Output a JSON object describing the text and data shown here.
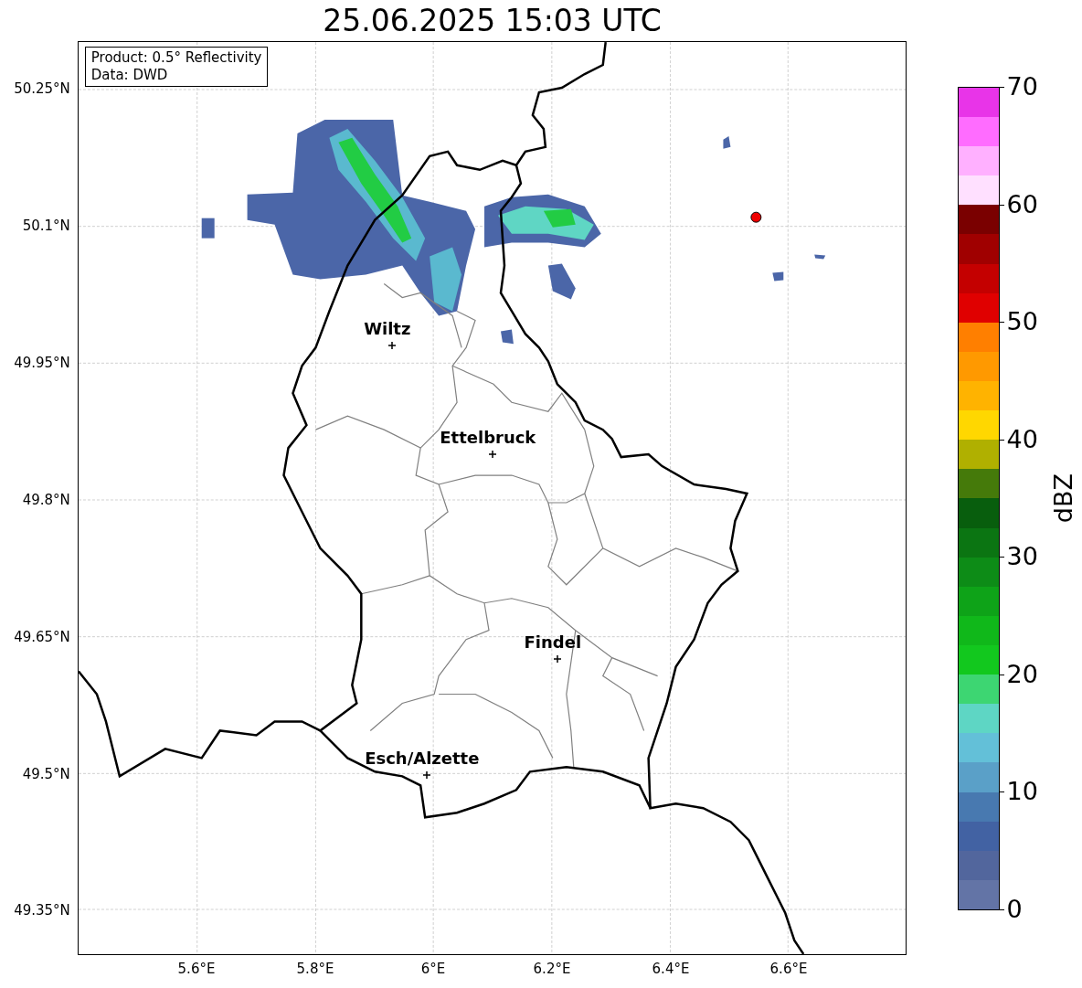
{
  "title": "25.06.2025 15:03 UTC",
  "map": {
    "info_lines": [
      "Product: 0.5° Reflectivity",
      "Data: DWD"
    ],
    "lat_ticks": [
      "50.25°N",
      "50.1°N",
      "49.95°N",
      "49.8°N",
      "49.65°N",
      "49.5°N",
      "49.35°N"
    ],
    "lon_ticks": [
      "5.6°E",
      "5.8°E",
      "6°E",
      "6.2°E",
      "6.4°E",
      "6.6°E"
    ],
    "cities": [
      {
        "name": "Wiltz"
      },
      {
        "name": "Ettelbruck"
      },
      {
        "name": "Findel"
      },
      {
        "name": "Esch/Alzette"
      }
    ]
  },
  "colorbar": {
    "label": "dBZ",
    "ticks": [
      "70",
      "60",
      "50",
      "40",
      "30",
      "20",
      "10",
      "0"
    ],
    "bins": [
      {
        "color": "#6374a6"
      },
      {
        "color": "#52669d"
      },
      {
        "color": "#4262a3"
      },
      {
        "color": "#4879b0"
      },
      {
        "color": "#5aa0c8"
      },
      {
        "color": "#63c0d8"
      },
      {
        "color": "#5ed6c4"
      },
      {
        "color": "#3dd672"
      },
      {
        "color": "#12c81e"
      },
      {
        "color": "#10b81a"
      },
      {
        "color": "#0ea318"
      },
      {
        "color": "#0d8c17"
      },
      {
        "color": "#0b7512"
      },
      {
        "color": "#085e0d"
      },
      {
        "color": "#457a0a"
      },
      {
        "color": "#b0b000"
      },
      {
        "color": "#ffd700"
      },
      {
        "color": "#ffb300"
      },
      {
        "color": "#ff9900"
      },
      {
        "color": "#ff7f00"
      },
      {
        "color": "#e00000"
      },
      {
        "color": "#c40000"
      },
      {
        "color": "#a00000"
      },
      {
        "color": "#7a0000"
      },
      {
        "color": "#ffe0ff"
      },
      {
        "color": "#ffb0ff"
      },
      {
        "color": "#ff6cff"
      },
      {
        "color": "#e834e8"
      }
    ]
  }
}
